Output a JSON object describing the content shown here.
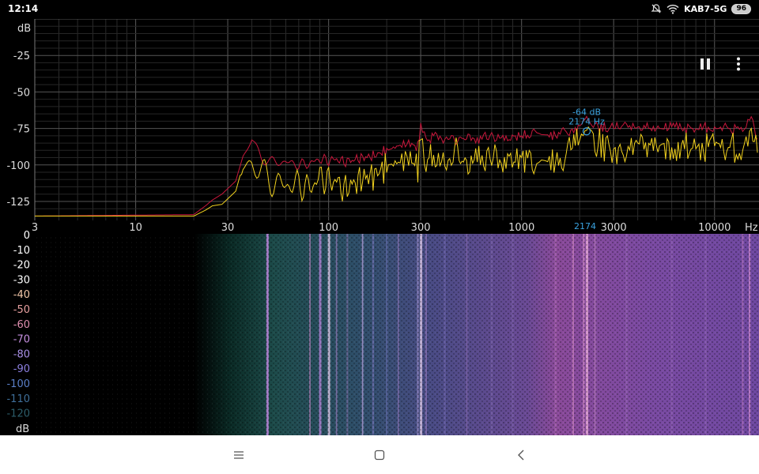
{
  "status_bar": {
    "time": "12:14",
    "network": "KAB7-5G",
    "battery": "96",
    "icons": [
      "bell-off-icon",
      "wifi-icon",
      "battery-icon"
    ]
  },
  "spectrum": {
    "y_unit": "dB",
    "x_unit": "Hz",
    "y_ticks": [
      "-25",
      "-50",
      "-75",
      "-100",
      "-125"
    ],
    "x_ticks": [
      "3",
      "10",
      "30",
      "100",
      "300",
      "1000",
      "3000",
      "10000"
    ],
    "cursor": {
      "level_label": "-64 dB",
      "freq_label": "2174 Hz",
      "axis_label": "2174",
      "freq_hz": 2174,
      "level_db": -64
    },
    "colors": {
      "live": "#f2d21e",
      "peak": "#c8173c",
      "cursor": "#3aa3e0",
      "grid": "#3a3a3a"
    }
  },
  "spectrogram": {
    "unit": "dB",
    "scale_labels": [
      "0",
      "-10",
      "-20",
      "-30",
      "-40",
      "-50",
      "-60",
      "-70",
      "-80",
      "-90",
      "-100",
      "-110",
      "-120"
    ],
    "scale_colors": [
      "#ffffff",
      "#ffffff",
      "#ffffff",
      "#ffffff",
      "#f2c7a8",
      "#e8a0a0",
      "#e08fb0",
      "#c68fe0",
      "#a98fe6",
      "#8c7fe0",
      "#5a7fc8",
      "#3f6f9a",
      "#2c5d6a"
    ]
  },
  "controls": {
    "icons": [
      "pause-icon",
      "more-vert-icon"
    ]
  },
  "chart_data": {
    "type": "line",
    "title": "",
    "xlabel": "Hz",
    "ylabel": "dB",
    "x_scale": "log",
    "xlim": [
      3,
      17000
    ],
    "ylim": [
      -138,
      0
    ],
    "grid": true,
    "series": [
      {
        "x": [
          3,
          20,
          23,
          25,
          28,
          33,
          36,
          40,
          45,
          50,
          60,
          70,
          80,
          90,
          100,
          110,
          120,
          130,
          150,
          170,
          200,
          230,
          260,
          290,
          300,
          320,
          350,
          400,
          450,
          500,
          600,
          700,
          800,
          1000,
          1200,
          1500,
          1800,
          2000,
          2174,
          2400,
          3000,
          4000,
          5000,
          6000,
          8000,
          10000,
          12000,
          14000,
          15500,
          17000
        ],
        "y": [
          -135,
          -135,
          -131,
          -128,
          -127,
          -118,
          -100,
          -95,
          -102,
          -108,
          -111,
          -110,
          -113,
          -105,
          -108,
          -108,
          -114,
          -111,
          -106,
          -104,
          -98,
          -95,
          -92,
          -98,
          -78,
          -95,
          -90,
          -96,
          -88,
          -95,
          -93,
          -91,
          -96,
          -92,
          -93,
          -95,
          -87,
          -80,
          -64,
          -82,
          -86,
          -82,
          -84,
          -85,
          -86,
          -84,
          -85,
          -87,
          -72,
          -96
        ]
      },
      {
        "x": [
          3,
          20,
          23,
          25,
          28,
          33,
          36,
          40,
          45,
          50,
          60,
          70,
          80,
          90,
          100,
          110,
          120,
          130,
          150,
          170,
          200,
          230,
          260,
          290,
          300,
          320,
          350,
          400,
          450,
          500,
          600,
          700,
          800,
          1000,
          1200,
          1500,
          1800,
          2000,
          2174,
          2400,
          3000,
          4000,
          5000,
          6000,
          8000,
          10000,
          12000,
          14000,
          15500,
          17000
        ],
        "y": [
          -135,
          -134,
          -128,
          -124,
          -120,
          -111,
          -94,
          -83,
          -95,
          -98,
          -98,
          -100,
          -99,
          -96,
          -97,
          -96,
          -98,
          -97,
          -95,
          -94,
          -90,
          -87,
          -85,
          -88,
          -72,
          -84,
          -80,
          -83,
          -82,
          -82,
          -82,
          -80,
          -82,
          -80,
          -79,
          -80,
          -76,
          -73,
          -70,
          -74,
          -75,
          -74,
          -75,
          -74,
          -75,
          -74,
          -75,
          -77,
          -67,
          -85
        ]
      }
    ]
  }
}
